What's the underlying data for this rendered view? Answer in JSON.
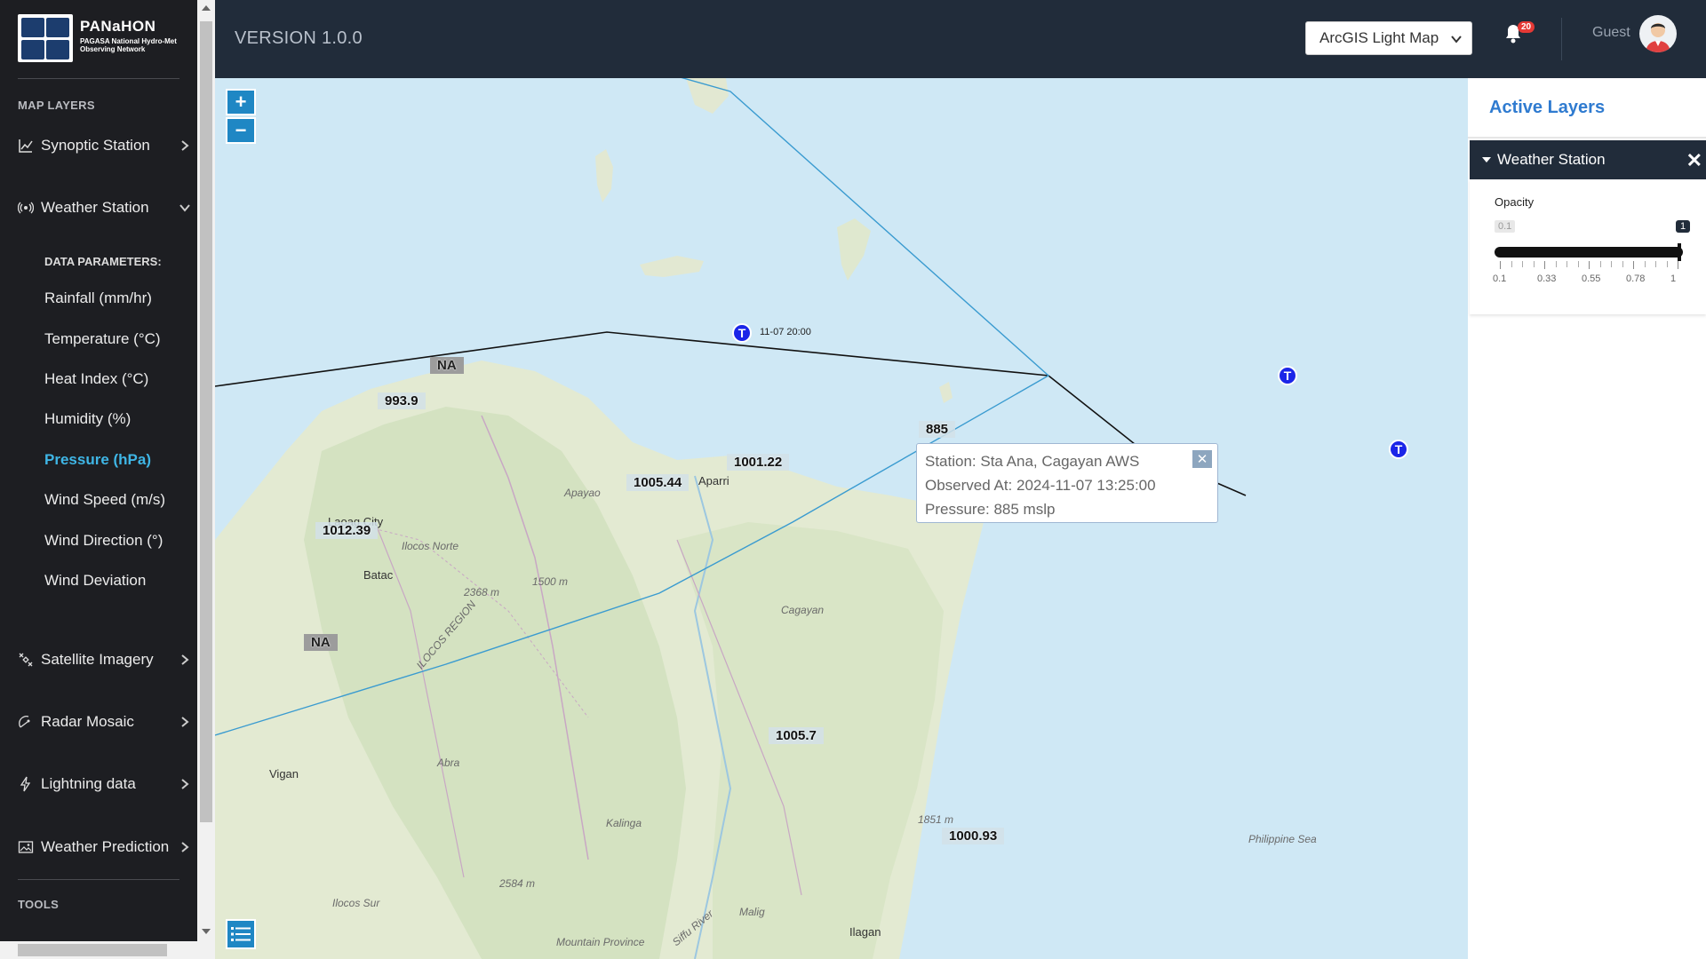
{
  "sidebar": {
    "logo_title": "PANaHON",
    "logo_subtitle": "PAGASA National Hydro-Met Observing Network",
    "map_layers_heading": "MAP LAYERS",
    "items": [
      {
        "label": "Synoptic Station",
        "icon": "chart-icon",
        "expanded": false
      },
      {
        "label": "Weather Station",
        "icon": "broadcast-icon",
        "expanded": true
      },
      {
        "label": "Satellite Imagery",
        "icon": "satellite-icon",
        "expanded": false
      },
      {
        "label": "Radar Mosaic",
        "icon": "radar-icon",
        "expanded": false
      },
      {
        "label": "Lightning data",
        "icon": "lightning-icon",
        "expanded": false
      },
      {
        "label": "Weather Prediction",
        "icon": "image-icon",
        "expanded": false
      }
    ],
    "data_parameters_heading": "DATA PARAMETERS:",
    "parameters": [
      "Rainfall (mm/hr)",
      "Temperature (°C)",
      "Heat Index (°C)",
      "Humidity (%)",
      "Pressure (hPa)",
      "Wind Speed (m/s)",
      "Wind Direction (°)",
      "Wind Deviation"
    ],
    "active_parameter": "Pressure (hPa)",
    "tools_heading": "TOOLS"
  },
  "topbar": {
    "version": "VERSION 1.0.0",
    "basemap_selected": "ArcGIS Light Map",
    "notification_count": "20",
    "user_label": "Guest"
  },
  "map": {
    "zoom_in": "+",
    "zoom_out": "−",
    "pressure_labels": [
      "993.9",
      "NA",
      "1001.22",
      "1005.44",
      "1012.39",
      "NA",
      "885",
      "1005.7",
      "1000.93"
    ],
    "places": [
      "Laoag City",
      "Ilocos Norte",
      "Batac",
      "Aparri",
      "Apayao",
      "Cagayan",
      "Vigan",
      "Abra",
      "Ilocos Sur",
      "Kalinga",
      "Malig",
      "Ilagan",
      "Mountain Province",
      "Philippine Sea",
      "ILOCOS REGION",
      "2368 m",
      "1500 m",
      "1851 m",
      "2584 m",
      "Siffu River"
    ],
    "track_time": "11-07 20:00",
    "track_marker": "T",
    "popup": {
      "station": "Station: Sta Ana, Cagayan AWS",
      "observed": "Observed At: 2024-11-07 13:25:00",
      "pressure": "Pressure: 885 mslp",
      "close": "✕"
    }
  },
  "panel": {
    "title": "Active Layers",
    "layer_name": "Weather Station",
    "opacity_label": "Opacity",
    "min_value": "0.1",
    "current_value": "1",
    "opacity_fraction": 1.0,
    "ticks": [
      "0.1",
      "0.33",
      "0.55",
      "0.78",
      "1"
    ]
  },
  "colors": {
    "sidebar_bg": "#1d1e22",
    "topbar_bg": "#212c3a",
    "active_param": "#3fb6e6",
    "panel_title": "#2f7bd0",
    "track_marker": "#1b25e8"
  }
}
